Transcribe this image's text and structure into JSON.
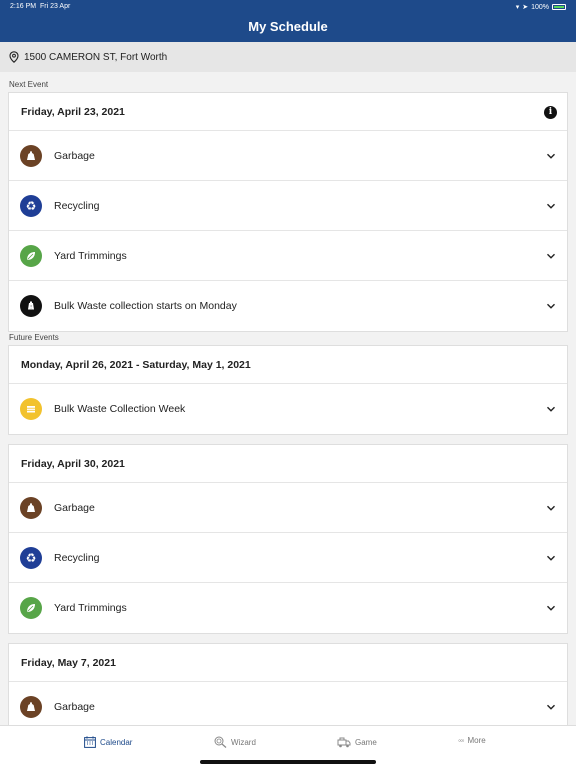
{
  "status": {
    "time": "2:16 PM",
    "date": "Fri 23 Apr",
    "battery": "100%"
  },
  "nav": {
    "title": "My Schedule"
  },
  "address": {
    "text": "1500 CAMERON ST, Fort Worth"
  },
  "sections": {
    "next_label": "Next Event",
    "future_label": "Future Events"
  },
  "colors": {
    "garbage": "#6b4225",
    "recycling": "#1f3e96",
    "yard": "#57a548",
    "bulk_notice": "#111111",
    "bulk_week": "#f2c22d",
    "accent": "#1e4a8a"
  },
  "next": {
    "date": "Friday, April 23, 2021",
    "items": [
      {
        "label": "Garbage",
        "icon": "garbage-icon"
      },
      {
        "label": "Recycling",
        "icon": "recycling-icon"
      },
      {
        "label": "Yard Trimmings",
        "icon": "leaf-icon"
      },
      {
        "label": "Bulk Waste collection starts on Monday",
        "icon": "bulk-notice-icon"
      }
    ]
  },
  "future": [
    {
      "date": "Monday, April 26, 2021 - Saturday, May 1, 2021",
      "items": [
        {
          "label": "Bulk Waste Collection Week",
          "icon": "bulk-icon"
        }
      ]
    },
    {
      "date": "Friday, April 30, 2021",
      "items": [
        {
          "label": "Garbage",
          "icon": "garbage-icon"
        },
        {
          "label": "Recycling",
          "icon": "recycling-icon"
        },
        {
          "label": "Yard Trimmings",
          "icon": "leaf-icon"
        }
      ]
    },
    {
      "date": "Friday, May 7, 2021",
      "items": [
        {
          "label": "Garbage",
          "icon": "garbage-icon"
        }
      ]
    }
  ],
  "tabs": {
    "calendar": "Calendar",
    "wizard": "Wizard",
    "game": "Game",
    "more": "More"
  }
}
